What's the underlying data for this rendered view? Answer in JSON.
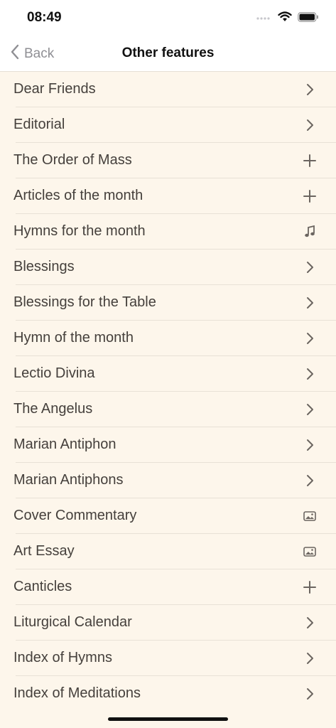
{
  "status": {
    "time": "08:49"
  },
  "nav": {
    "back_label": "Back",
    "title": "Other features"
  },
  "items": [
    {
      "label": "Dear Friends",
      "icon": "chevron-right-icon"
    },
    {
      "label": "Editorial",
      "icon": "chevron-right-icon"
    },
    {
      "label": "The Order of Mass",
      "icon": "plus-icon"
    },
    {
      "label": "Articles of the month",
      "icon": "plus-icon"
    },
    {
      "label": "Hymns for the month",
      "icon": "music-note-icon"
    },
    {
      "label": "Blessings",
      "icon": "chevron-right-icon"
    },
    {
      "label": "Blessings for the Table",
      "icon": "chevron-right-icon"
    },
    {
      "label": "Hymn of the month",
      "icon": "chevron-right-icon"
    },
    {
      "label": "Lectio Divina",
      "icon": "chevron-right-icon"
    },
    {
      "label": "The Angelus",
      "icon": "chevron-right-icon"
    },
    {
      "label": "Marian Antiphon",
      "icon": "chevron-right-icon"
    },
    {
      "label": "Marian Antiphons",
      "icon": "chevron-right-icon"
    },
    {
      "label": "Cover Commentary",
      "icon": "image-icon"
    },
    {
      "label": "Art Essay",
      "icon": "image-icon"
    },
    {
      "label": "Canticles",
      "icon": "plus-icon"
    },
    {
      "label": "Liturgical Calendar",
      "icon": "chevron-right-icon"
    },
    {
      "label": "Index of Hymns",
      "icon": "chevron-right-icon"
    },
    {
      "label": "Index of Meditations",
      "icon": "chevron-right-icon"
    }
  ],
  "colors": {
    "background": "#fdf6eb",
    "text": "#45403c",
    "icon": "#6b6560",
    "back": "#8f8f94"
  }
}
